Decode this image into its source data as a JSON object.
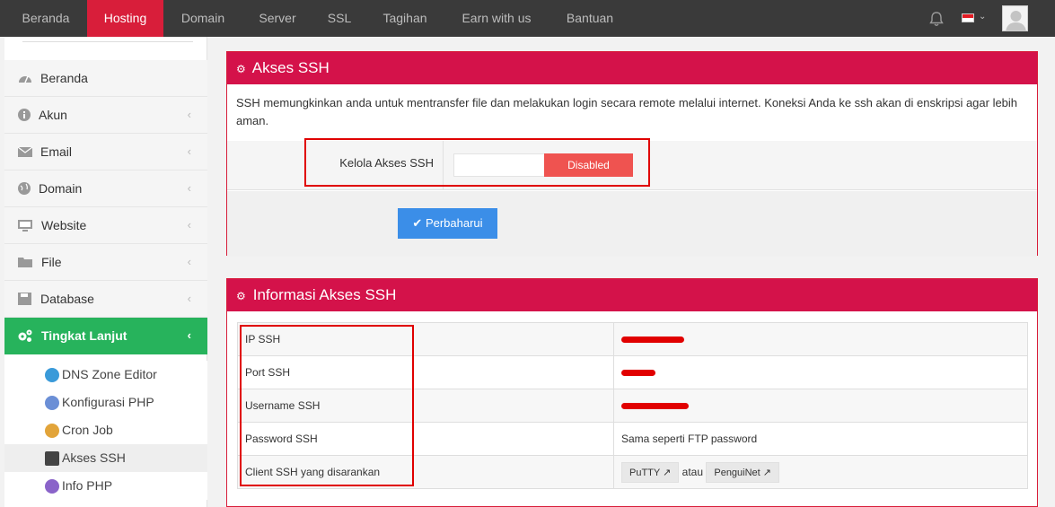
{
  "topnav": {
    "items": [
      {
        "label": "Beranda"
      },
      {
        "label": "Hosting"
      },
      {
        "label": "Domain"
      },
      {
        "label": "Server"
      },
      {
        "label": "SSL"
      },
      {
        "label": "Tagihan"
      },
      {
        "label": "Earn with us"
      },
      {
        "label": "Bantuan"
      }
    ],
    "active_index": 1
  },
  "sidebar": {
    "items": [
      {
        "label": "Beranda",
        "icon": "dashboard-icon"
      },
      {
        "label": "Akun",
        "icon": "info-icon"
      },
      {
        "label": "Email",
        "icon": "envelope-icon"
      },
      {
        "label": "Domain",
        "icon": "globe-icon"
      },
      {
        "label": "Website",
        "icon": "monitor-icon"
      },
      {
        "label": "File",
        "icon": "folder-icon"
      },
      {
        "label": "Database",
        "icon": "save-icon"
      },
      {
        "label": "Tingkat Lanjut",
        "icon": "cogs-icon"
      }
    ],
    "subitems": [
      {
        "label": "DNS Zone Editor"
      },
      {
        "label": "Konfigurasi PHP"
      },
      {
        "label": "Cron Job"
      },
      {
        "label": "Akses SSH"
      },
      {
        "label": "Info PHP"
      }
    ]
  },
  "ssh_panel": {
    "title": "Akses SSH",
    "description": "SSH memungkinkan anda untuk mentransfer file dan melakukan login secara remote melalui internet. Koneksi Anda ke ssh akan di enskripsi agar lebih aman.",
    "field_label": "Kelola Akses SSH",
    "toggle_label": "Disabled",
    "update_label": "Perbaharui"
  },
  "info_panel": {
    "title": "Informasi Akses SSH",
    "rows": [
      {
        "key": "IP SSH",
        "value": ""
      },
      {
        "key": "Port SSH",
        "value": ""
      },
      {
        "key": "Username SSH",
        "value": ""
      },
      {
        "key": "Password SSH",
        "value": "Sama seperti FTP password"
      },
      {
        "key": "Client SSH yang disarankan",
        "value": ""
      }
    ],
    "clients": {
      "putty": "PuTTY",
      "separator": "atau",
      "penguinet": "PenguiNet"
    }
  },
  "colors": {
    "topbar": "#3a3a3a",
    "active_tab": "#d81e3a",
    "panel_header": "#d4124a",
    "sidebar_active": "#27b35c",
    "toggle_disabled": "#ef5350",
    "update_button": "#3b8ee8"
  }
}
